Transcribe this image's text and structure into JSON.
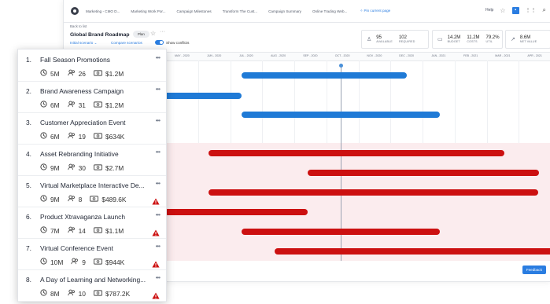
{
  "topbar": {
    "tabs": [
      "Marketing - CMO D...",
      "Marketing Work Por...",
      "Campaign Milestones",
      "Transform The Cust...",
      "Campaign Summary",
      "Online Trading Web..."
    ],
    "pin_label": "Pin current page",
    "help_label": "Help"
  },
  "header": {
    "breadcrumb": "Back to list",
    "title": "Global Brand Roadmap",
    "badge": "Plan",
    "scenario": "Initial scenario ⌄",
    "compare": "Compare scenarios",
    "show_conflicts": "Show conflicts"
  },
  "kpis": [
    {
      "items": [
        {
          "num": "95",
          "lbl": "AVAILABLE"
        },
        {
          "num": "102",
          "lbl": "REQUIRED"
        }
      ],
      "icon": "person-icon"
    },
    {
      "items": [
        {
          "num": "14.2M",
          "lbl": "BUDGET"
        },
        {
          "num": "11.2M",
          "lbl": "COSTS"
        },
        {
          "num": "79.2%",
          "lbl": "UTIL"
        }
      ],
      "icon": "money-icon"
    },
    {
      "items": [
        {
          "num": "8.6M",
          "lbl": "NET VALUE"
        }
      ],
      "icon": "trend-icon"
    }
  ],
  "timeline": {
    "months": [
      "MAY - 2020",
      "JUN - 2020",
      "JUL - 2020",
      "AUG - 2020",
      "SEP - 2020",
      "OCT - 2020",
      "NOV - 2020",
      "DEC - 2020",
      "JAN - 2021",
      "FEB - 2021",
      "MAR - 2021",
      "APR - 2021"
    ],
    "blue": "#1f7ad6",
    "red": "#cc1010"
  },
  "programs": [
    {
      "num": "1.",
      "name": "Fall Season Promotions",
      "duration": "5M",
      "people": "26",
      "budget": "$1.2M",
      "warning": false
    },
    {
      "num": "2.",
      "name": "Brand Awareness Campaign",
      "duration": "6M",
      "people": "31",
      "budget": "$1.2M",
      "warning": false
    },
    {
      "num": "3.",
      "name": "Customer Appreciation Event",
      "duration": "6M",
      "people": "19",
      "budget": "$634K",
      "warning": false
    },
    {
      "num": "4.",
      "name": "Asset Rebranding Initiative",
      "duration": "9M",
      "people": "30",
      "budget": "$2.7M",
      "warning": false
    },
    {
      "num": "5.",
      "name": "Virtual Marketplace Interactive De...",
      "duration": "9M",
      "people": "8",
      "budget": "$489.6K",
      "warning": true
    },
    {
      "num": "6.",
      "name": "Product Xtravaganza Launch",
      "duration": "7M",
      "people": "14",
      "budget": "$1.1M",
      "warning": true
    },
    {
      "num": "7.",
      "name": "Virtual Conference Event",
      "duration": "10M",
      "people": "9",
      "budget": "$944K",
      "warning": true
    },
    {
      "num": "8.",
      "name": "A Day of Learning and Networking...",
      "duration": "8M",
      "people": "10",
      "budget": "$787.2K",
      "warning": true
    }
  ],
  "feedback_label": "Feedback"
}
